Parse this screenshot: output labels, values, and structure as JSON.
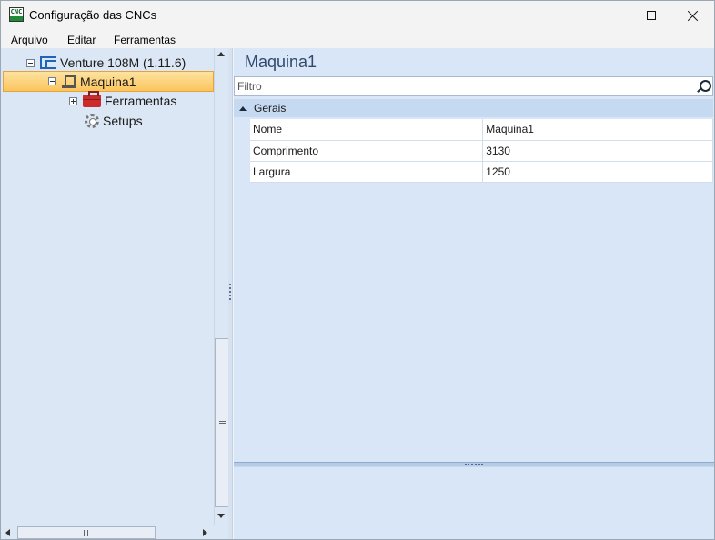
{
  "window": {
    "title": "Configuração das CNCs",
    "app_icon_text": "CNC"
  },
  "menu": [
    "Arquivo",
    "Editar",
    "Ferramentas"
  ],
  "tree": {
    "root": "Venture 108M (1.11.6)",
    "selected": "Maquina1",
    "children": [
      "Ferramentas",
      "Setups"
    ]
  },
  "details": {
    "title": "Maquina1",
    "filter_placeholder": "Filtro",
    "group": "Gerais",
    "properties": [
      {
        "name": "Nome",
        "value": "Maquina1"
      },
      {
        "name": "Comprimento",
        "value": "3130"
      },
      {
        "name": "Largura",
        "value": "1250"
      }
    ]
  },
  "colors": {
    "selection": "#fbc55e",
    "panel": "#d9e6f7",
    "group_header": "#c5d9f1",
    "cnc_icon": "#1f64b8",
    "toolbox_icon": "#cc2b2b"
  }
}
